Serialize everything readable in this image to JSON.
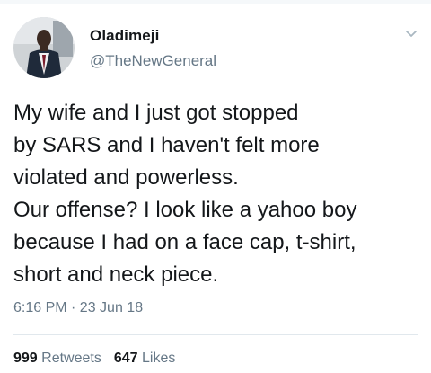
{
  "tweet": {
    "author_name": "Oladimeji",
    "author_handle": "@TheNewGeneral",
    "text": "My wife and I just got stopped\nby SARS and I haven't felt more\nviolated and powerless.\nOur offense? I look like a yahoo boy\nbecause I had on a face cap, t-shirt,\nshort and neck piece.",
    "timestamp": "6:16 PM · 23 Jun 18",
    "retweet_count": "999",
    "retweet_label": "Retweets",
    "like_count": "647",
    "like_label": "Likes"
  },
  "icons": {
    "menu": "chevron-down-icon",
    "avatar": "profile-photo"
  },
  "colors": {
    "text_primary": "#14171a",
    "text_secondary": "#657786",
    "divider": "#e1e8ed"
  }
}
